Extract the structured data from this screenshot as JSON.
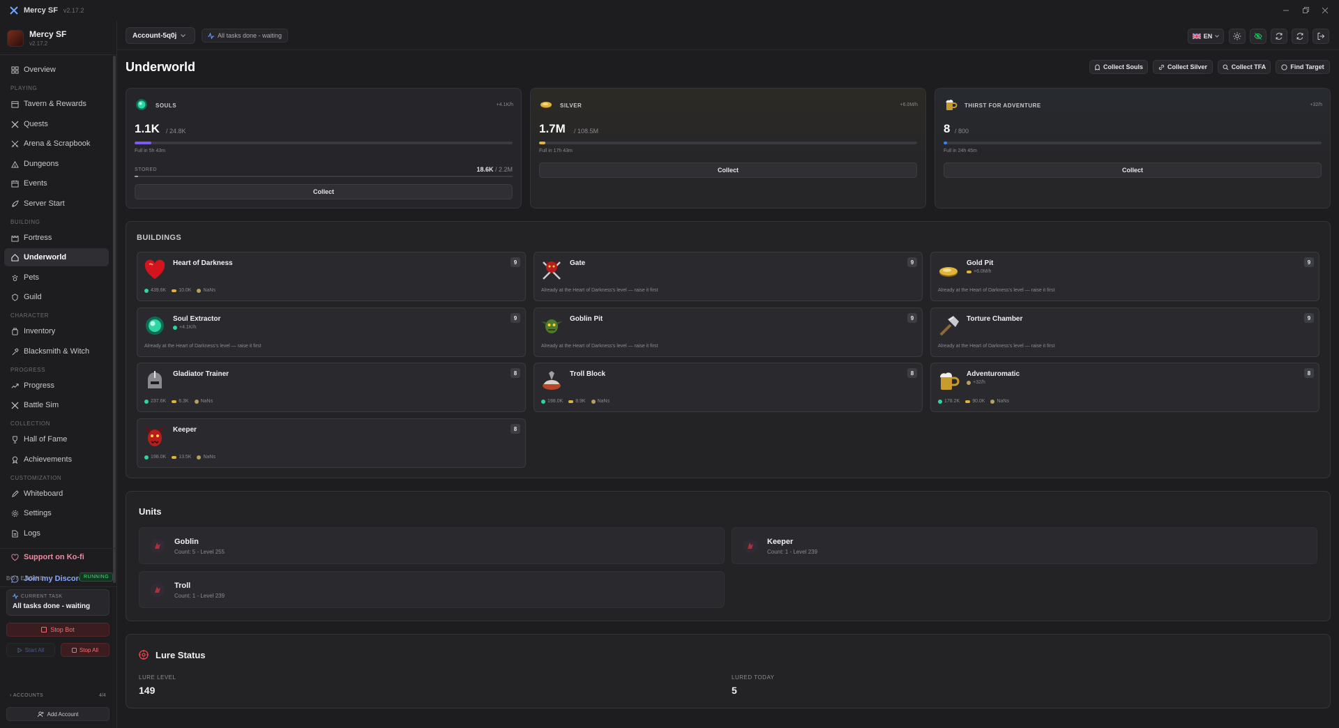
{
  "window": {
    "title": "Mercy SF",
    "version": "v2.17.2"
  },
  "sidebar": {
    "brand_name": "Mercy SF",
    "brand_version": "v2.17.2",
    "sections": {
      "playing": "PLAYING",
      "building": "BUILDING",
      "character": "CHARACTER",
      "progress": "PROGRESS",
      "collection": "COLLECTION",
      "customization": "CUSTOMIZATION"
    },
    "items": {
      "overview": "Overview",
      "tavern": "Tavern & Rewards",
      "quests": "Quests",
      "arena": "Arena & Scrapbook",
      "dungeons": "Dungeons",
      "events": "Events",
      "server_start": "Server Start",
      "fortress": "Fortress",
      "underworld": "Underworld",
      "pets": "Pets",
      "guild": "Guild",
      "inventory": "Inventory",
      "blacksmith": "Blacksmith & Witch",
      "progress": "Progress",
      "battle_sim": "Battle Sim",
      "hall_of_fame": "Hall of Fame",
      "achievements": "Achievements",
      "whiteboard": "Whiteboard",
      "settings": "Settings",
      "logs": "Logs",
      "kofi": "Support on Ko-fi",
      "discord": "Join my Discord"
    },
    "bot_engine": {
      "label": "BOT ENGINE",
      "status": "RUNNING",
      "current_task_label": "CURRENT TASK",
      "current_task": "All tasks done - waiting",
      "stop_bot": "Stop Bot",
      "start_all": "Start All",
      "stop_all": "Stop All"
    },
    "accounts": {
      "label": "ACCOUNTS",
      "count": "4/4",
      "add": "Add Account"
    }
  },
  "header": {
    "account": "Account-5q0j",
    "task_status": "All tasks done - waiting",
    "language": "EN"
  },
  "page": {
    "title": "Underworld",
    "actions": {
      "collect_souls": "Collect Souls",
      "collect_silver": "Collect Silver",
      "collect_tfa": "Collect TFA",
      "find_target": "Find Target"
    }
  },
  "resources": {
    "souls": {
      "label": "SOULS",
      "rate": "+4.1K/h",
      "value": "1.1K",
      "max": "/ 24.8K",
      "full_in": "Full in 5h 43m",
      "fill": 0.045,
      "stored_label": "STORED",
      "stored_value": "18.6K",
      "stored_max": "/ 2.2M",
      "stored_fill": 0.0085,
      "collect": "Collect",
      "color": "#7c5cf0"
    },
    "silver": {
      "label": "SILVER",
      "rate": "+6.0M/h",
      "value": "1.7M",
      "max": "/ 108.5M",
      "full_in": "Full in 17h 43m",
      "fill": 0.016,
      "collect": "Collect",
      "color": "#e0b33c"
    },
    "tfa": {
      "label": "THIRST FOR ADVENTURE",
      "rate": "+32/h",
      "value": "8",
      "max": "/ 800",
      "full_in": "Full in 24h 45m",
      "fill": 0.01,
      "collect": "Collect",
      "color": "#3b82f6"
    }
  },
  "buildings": {
    "title": "BUILDINGS",
    "items": [
      {
        "name": "Heart of Darkness",
        "level": "9",
        "sub": "",
        "souls": "439.6K",
        "gold": "10.0K",
        "time": "NaNs",
        "max_note": ""
      },
      {
        "name": "Gate",
        "level": "9",
        "sub": "",
        "max_note": "Already at the Heart of Darkness's level — raise it first"
      },
      {
        "name": "Gold Pit",
        "level": "9",
        "sub": "+6.0M/h",
        "max_note": "Already at the Heart of Darkness's level — raise it first"
      },
      {
        "name": "Soul Extractor",
        "level": "9",
        "sub": "+4.1K/h",
        "max_note": "Already at the Heart of Darkness's level — raise it first"
      },
      {
        "name": "Goblin Pit",
        "level": "9",
        "sub": "",
        "max_note": "Already at the Heart of Darkness's level — raise it first"
      },
      {
        "name": "Torture Chamber",
        "level": "9",
        "sub": "",
        "max_note": "Already at the Heart of Darkness's level — raise it first"
      },
      {
        "name": "Gladiator Trainer",
        "level": "8",
        "sub": "",
        "souls": "237.6K",
        "gold": "6.3K",
        "time": "NaNs"
      },
      {
        "name": "Troll Block",
        "level": "8",
        "sub": "",
        "souls": "198.0K",
        "gold": "8.9K",
        "time": "NaNs"
      },
      {
        "name": "Adventuromatic",
        "level": "8",
        "sub": "+32/h",
        "souls": "178.2K",
        "gold": "90.0K",
        "time": "NaNs"
      },
      {
        "name": "Keeper",
        "level": "8",
        "sub": "",
        "souls": "198.0K",
        "gold": "13.5K",
        "time": "NaNs"
      }
    ]
  },
  "units": {
    "title": "Units",
    "items": [
      {
        "name": "Goblin",
        "info": "Count: 5 - Level 255"
      },
      {
        "name": "Keeper",
        "info": "Count: 1 - Level 239"
      },
      {
        "name": "Troll",
        "info": "Count: 1 - Level 239"
      }
    ]
  },
  "lure": {
    "title": "Lure Status",
    "level_label": "LURE LEVEL",
    "level": "149",
    "today_label": "LURED TODAY",
    "today": "5"
  }
}
